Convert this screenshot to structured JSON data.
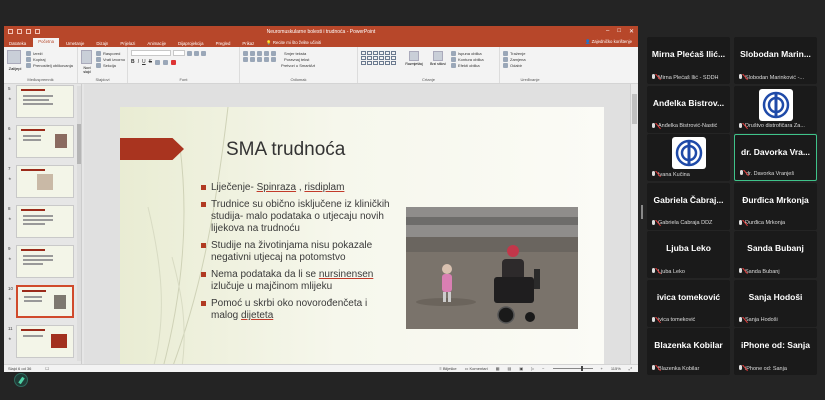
{
  "powerpoint": {
    "window_title": "Neuromuskularne bolesti i trudnoća - PowerPoint",
    "tabs": [
      "Datoteka",
      "Početna",
      "Umetanje",
      "Dizajn",
      "Prijelazi",
      "Animacije",
      "Dijaprojekcija",
      "Pregled",
      "Prikaz"
    ],
    "active_tab": "Početna",
    "tell_me": "Recite mi što želite učiniti",
    "share": "Zajedničko korištenje",
    "ribbon": {
      "clipboard": {
        "paste": "Zalijepi",
        "cut": "Izreži",
        "copy": "Kopiraj",
        "format_painter": "Prenositelj oblikovanja",
        "label": "Međuspremnik"
      },
      "slides": {
        "new_slide": "Novi slajd",
        "layout": "Raspored",
        "reset": "Vrati izvorno",
        "section": "Sekcija",
        "label": "Slajdovi"
      },
      "font": {
        "label": "Font"
      },
      "paragraph": {
        "label": "Odlomak",
        "text_direction": "Smjer teksta",
        "align_text": "Poravnaj tekst",
        "smartart": "Pretvori u SmartArt"
      },
      "drawing": {
        "arrange": "Razmještaj",
        "quick_styles": "Brzi stilovi",
        "shape_fill": "Ispuna oblika",
        "shape_outline": "Kontura oblika",
        "shape_effects": "Efekti oblika",
        "label": "Crtanje"
      },
      "editing": {
        "find": "Traženje",
        "replace": "Zamjena",
        "select": "Odabir",
        "label": "Uređivanje"
      }
    },
    "thumbnails": [
      {
        "num": "5"
      },
      {
        "num": "6"
      },
      {
        "num": "7"
      },
      {
        "num": "8"
      },
      {
        "num": "9"
      },
      {
        "num": "10",
        "active": true
      },
      {
        "num": "11"
      }
    ],
    "slide": {
      "title": "SMA trudnoća",
      "bullets": [
        {
          "before": "Liječenje- ",
          "u1": "Spinraza",
          "mid": " , ",
          "u2": "risdiplam",
          "after": ""
        },
        {
          "before": "Trudnice su obično isključene iz kliničkih studija- malo podataka o utjecaju novih lijekova na trudnoću",
          "u1": "",
          "mid": "",
          "u2": "",
          "after": ""
        },
        {
          "before": "Studije na životinjama nisu pokazale negativni utjecaj na potomstvo",
          "u1": "",
          "mid": "",
          "u2": "",
          "after": ""
        },
        {
          "before": "Nema podataka da li se ",
          "u1": "nursinensen",
          "mid": " izlučuje u majčinom mlijeku",
          "u2": "",
          "after": ""
        },
        {
          "before": "Pomoć u skrbi oko novorođenčeta i malog ",
          "u1": "dijeteta",
          "mid": "",
          "u2": "",
          "after": ""
        }
      ]
    },
    "status": {
      "slide_info": "Slajd 6 od 36",
      "language": "Bilješke",
      "comments": "Komentari",
      "zoom": "115%"
    }
  },
  "participants": [
    {
      "big": "Mirna Plećaš Ilić...",
      "small": "Mirna Plećaš Ilić - SDDH",
      "logo": false,
      "active": false
    },
    {
      "big": "Slobodan Marin...",
      "small": "Slobodan Marinković -...",
      "logo": false,
      "active": false
    },
    {
      "big": "Anđelka Bistrov...",
      "small": "Anđelka Bistrović-Nastić",
      "logo": false,
      "active": false
    },
    {
      "big": "",
      "small": "Društvo distrofičara Za...",
      "logo": true,
      "active": false
    },
    {
      "big": "",
      "small": "Ivana Kučina",
      "logo": true,
      "active": false
    },
    {
      "big": "dr. Davorka Vra...",
      "small": "dr. Davorka Vranješ",
      "logo": false,
      "active": true
    },
    {
      "big": "Gabriela Čabraj...",
      "small": "Gabriela Čabraja DDZ",
      "logo": false,
      "active": false
    },
    {
      "big": "Đurđica Mrkonja",
      "small": "Đurđica Mrkonja",
      "logo": false,
      "active": false
    },
    {
      "big": "Ljuba Leko",
      "small": "Ljuba Leko",
      "logo": false,
      "active": false
    },
    {
      "big": "Sanda Bubanj",
      "small": "Sanda Bubanj",
      "logo": false,
      "active": false
    },
    {
      "big": "ivica tomeković",
      "small": "ivica tomeković",
      "logo": false,
      "active": false
    },
    {
      "big": "Sanja Hodoši",
      "small": "Sanja Hodoši",
      "logo": false,
      "active": false
    },
    {
      "big": "Blazenka Kobilar",
      "small": "Blazenka Kobilar",
      "logo": false,
      "active": false
    },
    {
      "big": "iPhone od: Sanja",
      "small": "iPhone od: Sanja",
      "logo": false,
      "active": false
    }
  ],
  "colors": {
    "accent": "#b7472a",
    "active_border": "#3fc38a",
    "slide_bullet": "#b13a22"
  }
}
